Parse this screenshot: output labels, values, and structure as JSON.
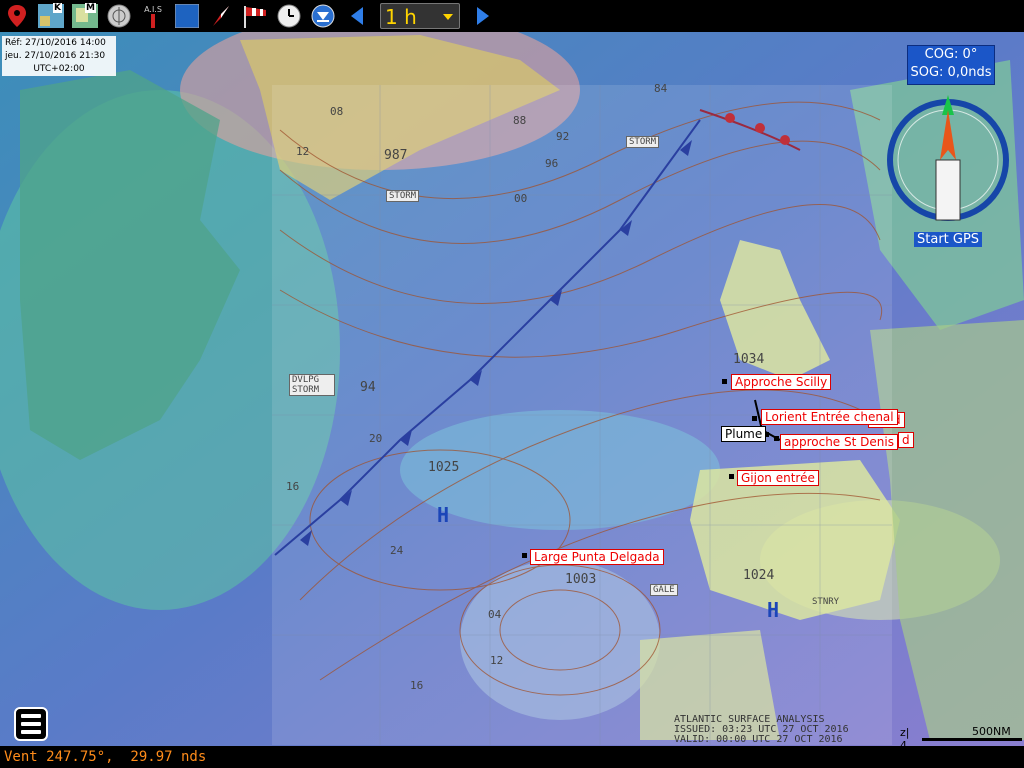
{
  "toolbar": {
    "icons": [
      "map-pin-icon",
      "kap-chart-icon",
      "mbtiles-chart-icon",
      "gps-device-icon",
      "ais-icon",
      "grib-layer-icon",
      "compass-icon",
      "windsock-icon",
      "clock-icon",
      "download-icon",
      "back-arrow-icon",
      "forward-arrow-icon"
    ],
    "kap_label": "K",
    "mbtiles_label": "M",
    "ais_label": "A.I.S",
    "time_step": "1 h"
  },
  "info": {
    "ref_date": "Réf: 27/10/2016 14:00",
    "forecast_date": "jeu. 27/10/2016 21:30",
    "timezone": "UTC+02:00"
  },
  "navigation": {
    "cog": "COG: 0°",
    "sog": "SOG: 0,0nds",
    "start_gps": "Start GPS"
  },
  "waypoints": [
    {
      "label": "Approche Scilly"
    },
    {
      "label": "Lorient Entrée chenal"
    },
    {
      "label": "Nord"
    },
    {
      "label": "Plume"
    },
    {
      "label": "approche St Denis"
    },
    {
      "label": "d"
    },
    {
      "label": "Gijon entrée"
    },
    {
      "label": "Large Punta Delgada"
    }
  ],
  "weather_chart": {
    "pressures": [
      "987",
      "1034",
      "1025",
      "1003",
      "1024",
      "94"
    ],
    "highs_lows": [
      "H",
      "H"
    ],
    "tags": [
      "STORM",
      "STORM",
      "DVLPG STORM",
      "GALE",
      "STNRY"
    ],
    "isobar_labels": [
      "08",
      "12",
      "88",
      "92",
      "96",
      "00",
      "04",
      "12",
      "16",
      "20",
      "16",
      "24",
      "84"
    ],
    "legend_title": "ATLANTIC SURFACE ANALYSIS",
    "legend_issued": "ISSUED:  03:23 UTC 27 OCT 2016",
    "legend_valid": "VALID:   00:00 UTC 27 OCT 2016"
  },
  "scale": {
    "label": "500NM",
    "zoom": "z| 4"
  },
  "status": {
    "text": "Vent 247.75°,  29.97 nds"
  },
  "colors": {
    "waypoint_text": "#e00000",
    "status_text": "#ff8c1a",
    "nav_box": "#1b56c8"
  }
}
